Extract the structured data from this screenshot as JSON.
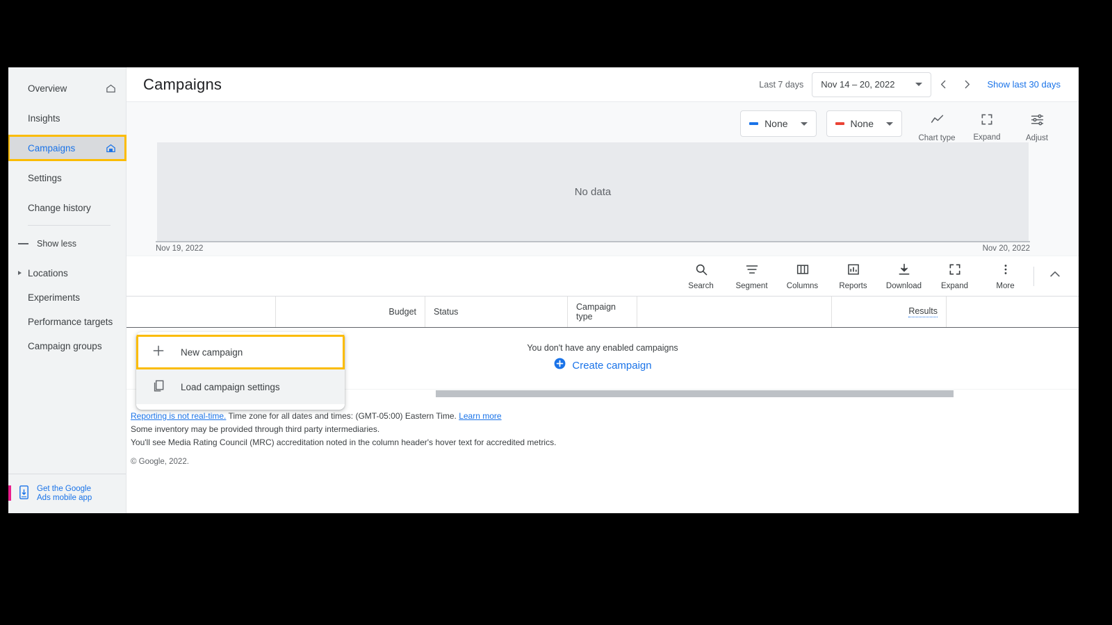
{
  "sidebar": {
    "items": [
      {
        "label": "Overview",
        "icon": "home-outline-icon",
        "selected": false
      },
      {
        "label": "Insights",
        "icon": "",
        "selected": false
      },
      {
        "label": "Campaigns",
        "icon": "home-filled-icon",
        "selected": true
      },
      {
        "label": "Settings",
        "icon": "",
        "selected": false
      },
      {
        "label": "Change history",
        "icon": "",
        "selected": false
      }
    ],
    "show_less_label": "Show less",
    "sub_items": [
      {
        "label": "Locations",
        "expandable": true
      },
      {
        "label": "Experiments",
        "expandable": false
      },
      {
        "label": "Performance targets",
        "expandable": false
      },
      {
        "label": "Campaign groups",
        "expandable": false
      }
    ],
    "mobile_app": {
      "line1": "Get the Google",
      "line2": "Ads mobile app",
      "icon": "mobile-download-icon"
    }
  },
  "header": {
    "title": "Campaigns",
    "date_preset": "Last 7 days",
    "date_range": "Nov 14 – 20, 2022",
    "prev_icon": "chevron-left-icon",
    "next_icon": "chevron-right-icon",
    "show_last_30": "Show last 30 days"
  },
  "chart": {
    "metric_left": {
      "label": "None",
      "color": "#1a73e8"
    },
    "metric_right": {
      "label": "None",
      "color": "#ea4335"
    },
    "buttons": [
      {
        "label": "Chart type",
        "icon": "line-chart-icon"
      },
      {
        "label": "Expand",
        "icon": "expand-icon"
      },
      {
        "label": "Adjust",
        "icon": "adjust-sliders-icon"
      }
    ],
    "empty_text": "No data",
    "axis_start": "Nov 19, 2022",
    "axis_end": "Nov 20, 2022"
  },
  "chart_data": {
    "type": "line",
    "title": "",
    "series": [
      {
        "name": "None",
        "color": "#1a73e8",
        "values": []
      },
      {
        "name": "None",
        "color": "#ea4335",
        "values": []
      }
    ],
    "x": [],
    "categories": [],
    "values": [],
    "xlabel": "",
    "ylabel": "",
    "xticks": [
      "Nov 19, 2022",
      "Nov 20, 2022"
    ],
    "grid": false,
    "legend": "top-right",
    "empty": true,
    "empty_text": "No data"
  },
  "toolbar": {
    "buttons": [
      {
        "label": "Search",
        "icon": "search-icon"
      },
      {
        "label": "Segment",
        "icon": "segment-icon"
      },
      {
        "label": "Columns",
        "icon": "columns-icon"
      },
      {
        "label": "Reports",
        "icon": "reports-icon"
      },
      {
        "label": "Download",
        "icon": "download-icon"
      },
      {
        "label": "Expand",
        "icon": "expand-icon"
      },
      {
        "label": "More",
        "icon": "more-vert-icon"
      }
    ],
    "collapse_icon": "chevron-up-icon"
  },
  "table": {
    "columns": [
      {
        "label": "",
        "align": "left",
        "width": "215"
      },
      {
        "label": "Budget",
        "align": "right",
        "width": "215"
      },
      {
        "label": "Status",
        "align": "left",
        "width": "205"
      },
      {
        "label": "Campaign type",
        "align": "left",
        "width": "100"
      },
      {
        "label": "",
        "align": "left",
        "width": "70"
      },
      {
        "label": "Results",
        "align": "right",
        "width": "285",
        "underline": "dotted"
      },
      {
        "label": "",
        "align": "left",
        "width": "120"
      }
    ],
    "empty_message": "You don't have any enabled campaigns",
    "create_label": "Create campaign",
    "create_icon": "plus-circle-icon"
  },
  "footer": {
    "link1": "Reporting is not real-time.",
    "line1_rest": " Time zone for all dates and times: (GMT-05:00) Eastern Time. ",
    "link2": "Learn more",
    "line2": "Some inventory may be provided through third party intermediaries.",
    "line3": "You'll see Media Rating Council (MRC) accreditation noted in the column header's hover text for accredited metrics.",
    "copyright": "© Google, 2022."
  },
  "popup": {
    "items": [
      {
        "label": "New campaign",
        "icon": "plus-icon",
        "state": "focused"
      },
      {
        "label": "Load campaign settings",
        "icon": "copy-icon",
        "state": "hovered"
      }
    ]
  },
  "colors": {
    "accent": "#1a73e8",
    "focus_ring": "#fbbc04",
    "red": "#ea4335",
    "sidebar_bg": "#f1f3f4",
    "chart_bg": "#e8eaed"
  }
}
